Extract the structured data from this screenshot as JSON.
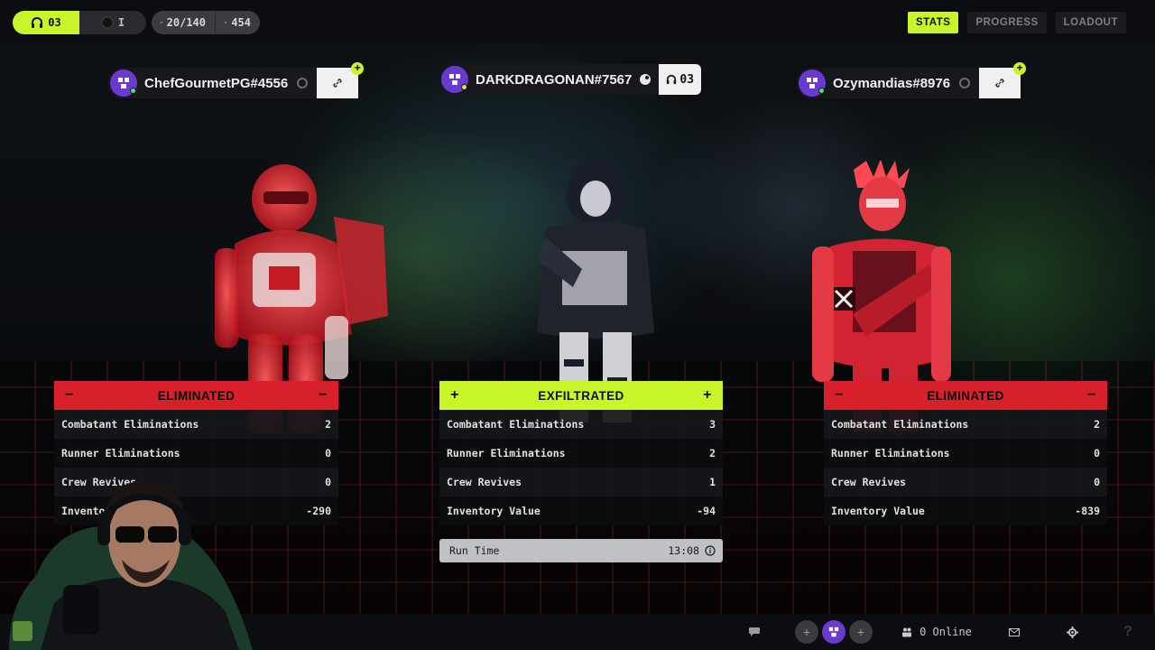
{
  "topbar": {
    "level_value": "03",
    "secondary_value": "I",
    "inventory_count": "20/140",
    "currency": "454",
    "tabs": [
      {
        "label": "STATS",
        "active": true
      },
      {
        "label": "PROGRESS",
        "active": false
      },
      {
        "label": "LOADOUT",
        "active": false
      }
    ]
  },
  "players": [
    {
      "name": "ChefGourmetPG#4556",
      "status": "ELIMINATED"
    },
    {
      "name": "DARKDRAGONAN#7567",
      "level": "03",
      "status": "EXFILTRATED"
    },
    {
      "name": "Ozymandias#8976",
      "status": "ELIMINATED"
    }
  ],
  "stats": {
    "labels": [
      "Combatant Eliminations",
      "Runner Eliminations",
      "Crew Revives",
      "Inventory Value"
    ],
    "left": [
      "2",
      "0",
      "0",
      "-290"
    ],
    "center": [
      "3",
      "2",
      "1",
      "-94"
    ],
    "right": [
      "2",
      "0",
      "0",
      "-839"
    ],
    "left_partial_labels": [
      "Combatant Eliminations",
      "Runner Eliminations",
      "Crew Revives",
      "Inventor"
    ]
  },
  "run_time": {
    "label": "Run Time",
    "value": "13:08"
  },
  "bottombar": {
    "online_text": "0 Online"
  },
  "colors": {
    "accent": "#c8f52a",
    "eliminated": "#d8202c",
    "avatar": "#6a3ad0"
  }
}
